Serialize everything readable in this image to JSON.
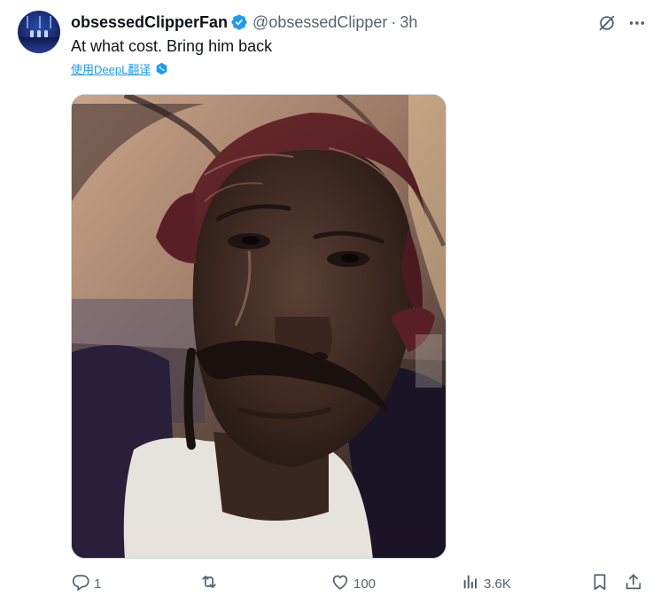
{
  "tweet": {
    "display_name": "obsessedClipperFan",
    "handle": "@obsessedClipper",
    "separator": "·",
    "time": "3h",
    "text": "At what cost. Bring him back",
    "translate_label": "使用DeepL翻译"
  },
  "actions": {
    "replies": "1",
    "reposts": "",
    "likes": "100",
    "views": "3.6K"
  },
  "icons": {
    "verified": "verified-badge-icon",
    "grok": "grok-icon",
    "more": "more-icon",
    "reply": "reply-icon",
    "repost": "repost-icon",
    "like": "like-icon",
    "views": "views-icon",
    "bookmark": "bookmark-icon",
    "share": "share-icon",
    "translate": "translate-icon"
  },
  "colors": {
    "text": "#0f1419",
    "secondary": "#536471",
    "accent": "#1d9bf0",
    "border": "#cfd9de"
  }
}
